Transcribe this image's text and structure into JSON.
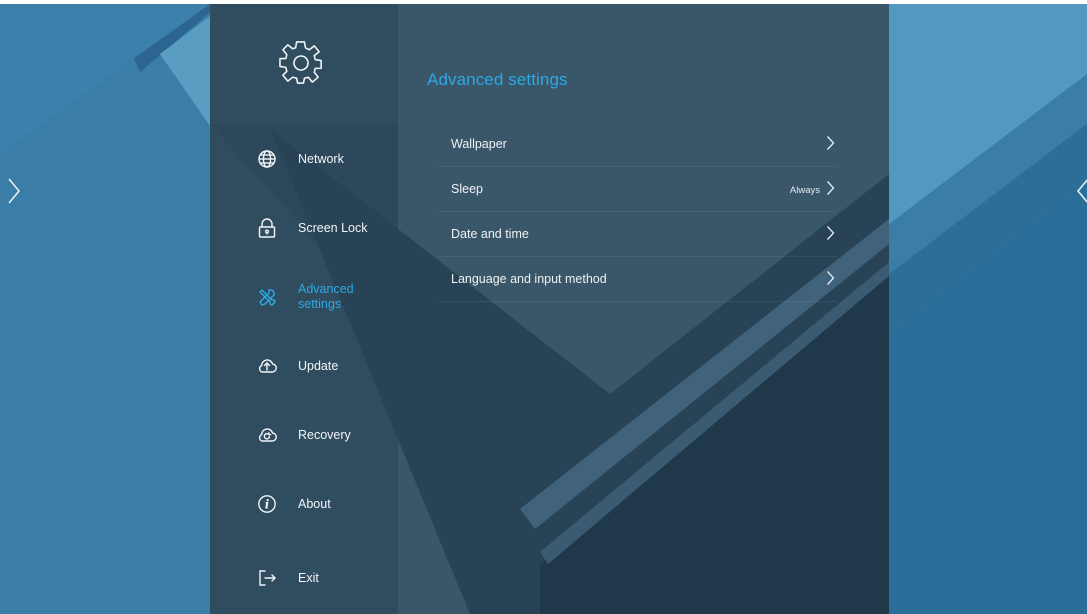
{
  "header": {
    "title": "Advanced settings",
    "settings_icon": "gear-icon"
  },
  "nav": {
    "items": [
      {
        "label": "Network",
        "icon": "globe-icon",
        "active": false
      },
      {
        "label": "Screen Lock",
        "icon": "lock-icon",
        "active": false
      },
      {
        "label": "Advanced settings",
        "icon": "tools-icon",
        "active": true
      },
      {
        "label": "Update",
        "icon": "cloud-upload-icon",
        "active": false
      },
      {
        "label": "Recovery",
        "icon": "cloud-restore-icon",
        "active": false
      },
      {
        "label": "About",
        "icon": "info-icon",
        "active": false
      },
      {
        "label": "Exit",
        "icon": "exit-icon",
        "active": false
      }
    ]
  },
  "settings": {
    "rows": [
      {
        "label": "Wallpaper",
        "value": ""
      },
      {
        "label": "Sleep",
        "value": "Always"
      },
      {
        "label": "Date and time",
        "value": ""
      },
      {
        "label": "Language and input method",
        "value": ""
      }
    ]
  },
  "colors": {
    "accent": "#2aa9e6",
    "panel": "#2e5065",
    "background": "#3a7ea8"
  }
}
